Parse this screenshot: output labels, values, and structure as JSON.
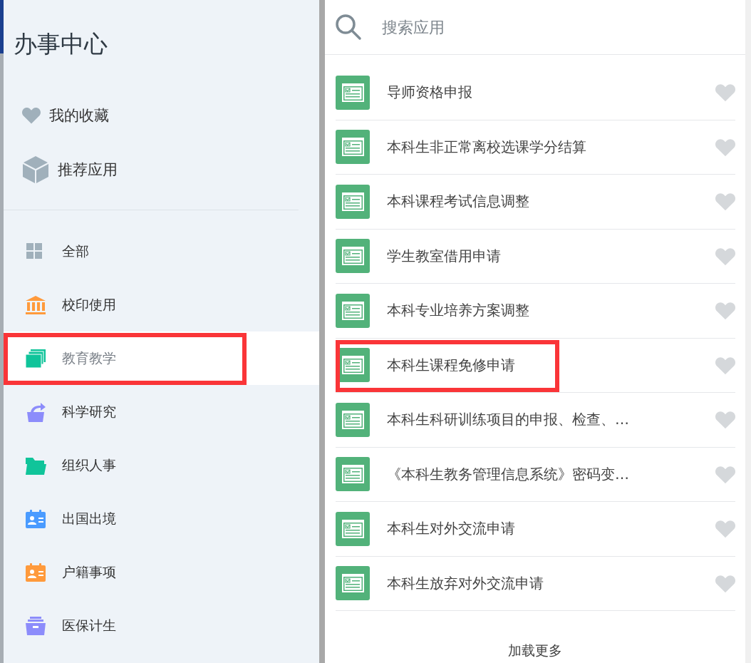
{
  "sidebar": {
    "title": "办事中心",
    "shortcuts": [
      {
        "kind": "heart",
        "label": "我的收藏"
      },
      {
        "kind": "cube",
        "label": "推荐应用"
      }
    ],
    "categories": [
      {
        "kind": "grid",
        "color": "#a0b0bb",
        "label": "全部",
        "selected": false,
        "highlighted": false
      },
      {
        "kind": "bank",
        "color": "#ff9a3c",
        "label": "校印使用",
        "selected": false,
        "highlighted": false
      },
      {
        "kind": "stack",
        "color": "#10c49a",
        "label": "教育教学",
        "selected": true,
        "highlighted": true
      },
      {
        "kind": "share",
        "color": "#8c8cfb",
        "label": "科学研究",
        "selected": false,
        "highlighted": false
      },
      {
        "kind": "folder",
        "color": "#10c49a",
        "label": "组织人事",
        "selected": false,
        "highlighted": false
      },
      {
        "kind": "idcard",
        "color": "#4a9bff",
        "label": "出国出境",
        "selected": false,
        "highlighted": false
      },
      {
        "kind": "idcard",
        "color": "#ff9a3c",
        "label": "户籍事项",
        "selected": false,
        "highlighted": false
      },
      {
        "kind": "archive",
        "color": "#8c8cfb",
        "label": "医保计生",
        "selected": false,
        "highlighted": false
      }
    ]
  },
  "search": {
    "placeholder": "搜索应用"
  },
  "apps": [
    {
      "name": "导师资格申报",
      "favorited": false,
      "highlighted": false
    },
    {
      "name": "本科生非正常离校选课学分结算",
      "favorited": false,
      "highlighted": false
    },
    {
      "name": "本科课程考试信息调整",
      "favorited": false,
      "highlighted": false
    },
    {
      "name": "学生教室借用申请",
      "favorited": false,
      "highlighted": false
    },
    {
      "name": "本科专业培养方案调整",
      "favorited": false,
      "highlighted": false
    },
    {
      "name": "本科生课程免修申请",
      "favorited": false,
      "highlighted": true
    },
    {
      "name": "本科生科研训练项目的申报、检查、…",
      "favorited": false,
      "highlighted": false
    },
    {
      "name": "《本科生教务管理信息系统》密码变…",
      "favorited": false,
      "highlighted": false
    },
    {
      "name": "本科生对外交流申请",
      "favorited": false,
      "highlighted": false
    },
    {
      "name": "本科生放弃对外交流申请",
      "favorited": false,
      "highlighted": false
    }
  ],
  "load_more": "加载更多"
}
